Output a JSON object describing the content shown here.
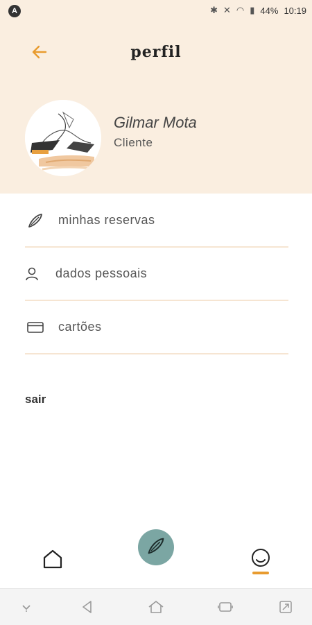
{
  "status_bar": {
    "battery": "44%",
    "time": "10:19"
  },
  "header": {
    "title": "perfil"
  },
  "profile": {
    "name": "Gilmar Mota",
    "role": "Cliente"
  },
  "menu": {
    "items": [
      {
        "label": "minhas reservas",
        "icon": "surfboard-icon"
      },
      {
        "label": "dados pessoais",
        "icon": "person-icon"
      },
      {
        "label": "cartões",
        "icon": "card-icon"
      }
    ]
  },
  "logout": {
    "label": "sair"
  },
  "colors": {
    "accent": "#e89b2f",
    "header_bg": "#faeee0",
    "fab": "#7ba6a3",
    "divider": "#f6e5d2"
  }
}
